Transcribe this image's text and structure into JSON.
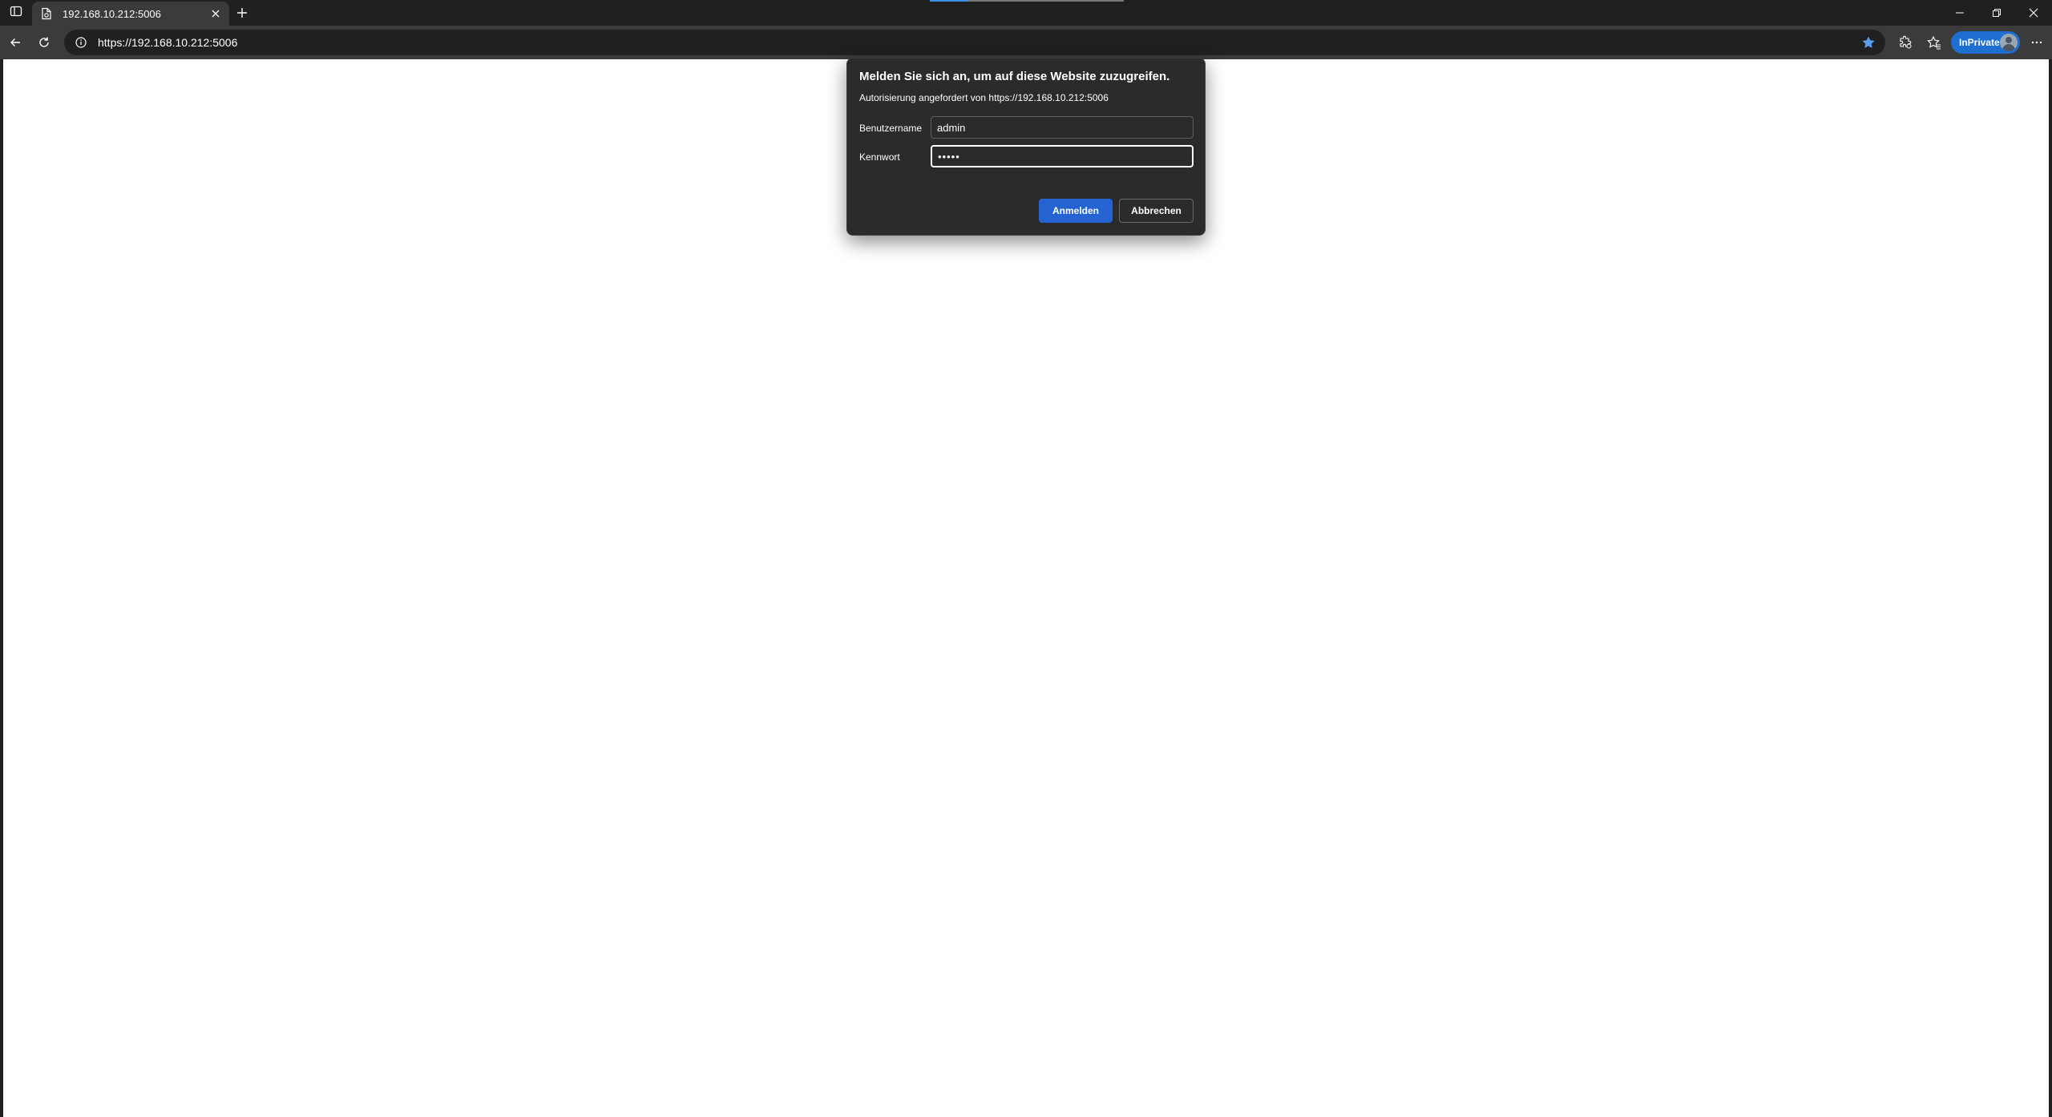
{
  "browser": {
    "tab": {
      "title": "192.168.10.212:5006"
    },
    "address_bar": {
      "url": "https://192.168.10.212:5006"
    },
    "profile": {
      "label": "InPrivate"
    },
    "icons": {
      "tab_actions": "tab-actions-icon",
      "favicon": "page-favicon-icon",
      "tab_close": "close-icon",
      "new_tab": "plus-icon",
      "back": "back-arrow-icon",
      "reload": "reload-icon",
      "site_info": "info-icon",
      "favorite": "star-icon",
      "extensions": "extensions-icon",
      "favorites": "favorites-icon",
      "more": "more-icon",
      "minimize": "minimize-icon",
      "restore": "restore-icon",
      "close_window": "close-icon"
    },
    "colors": {
      "accent": "#2463d1",
      "inprivate": "#1f6fd1",
      "chrome": "#3b3b3b",
      "frame": "#202020"
    }
  },
  "auth_dialog": {
    "title": "Melden Sie sich an, um auf diese Website zuzugreifen.",
    "subtitle": "Autorisierung angefordert von https://192.168.10.212:5006",
    "username_label": "Benutzername",
    "username_value": "admin",
    "password_label": "Kennwort",
    "password_value": "•••••",
    "login_button": "Anmelden",
    "cancel_button": "Abbrechen"
  }
}
